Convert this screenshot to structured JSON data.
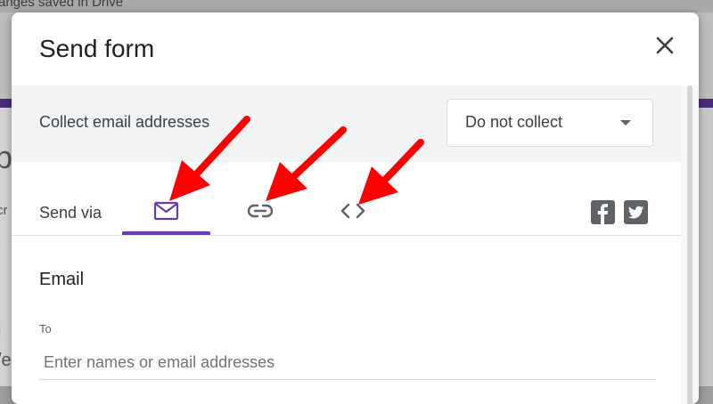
{
  "background": {
    "saved_text": "anges saved in Drive",
    "left_glyph": "p",
    "left_glyph2": "i",
    "left_glyph3": "/e",
    "left_glyph4": "cr"
  },
  "dialog": {
    "title": "Send form",
    "collect_label": "Collect email addresses",
    "collect_select_value": "Do not collect",
    "send_via_label": "Send via",
    "tabs": [
      {
        "name": "email",
        "icon": "mail-icon",
        "active": true
      },
      {
        "name": "link",
        "icon": "link-icon",
        "active": false
      },
      {
        "name": "embed",
        "icon": "code-icon",
        "active": false
      }
    ],
    "social": [
      "facebook-icon",
      "twitter-icon"
    ],
    "email_heading": "Email",
    "to_label": "To",
    "to_placeholder": "Enter names or email addresses"
  },
  "colors": {
    "accent": "#673ab7",
    "annotation_arrow": "#ff0000"
  }
}
